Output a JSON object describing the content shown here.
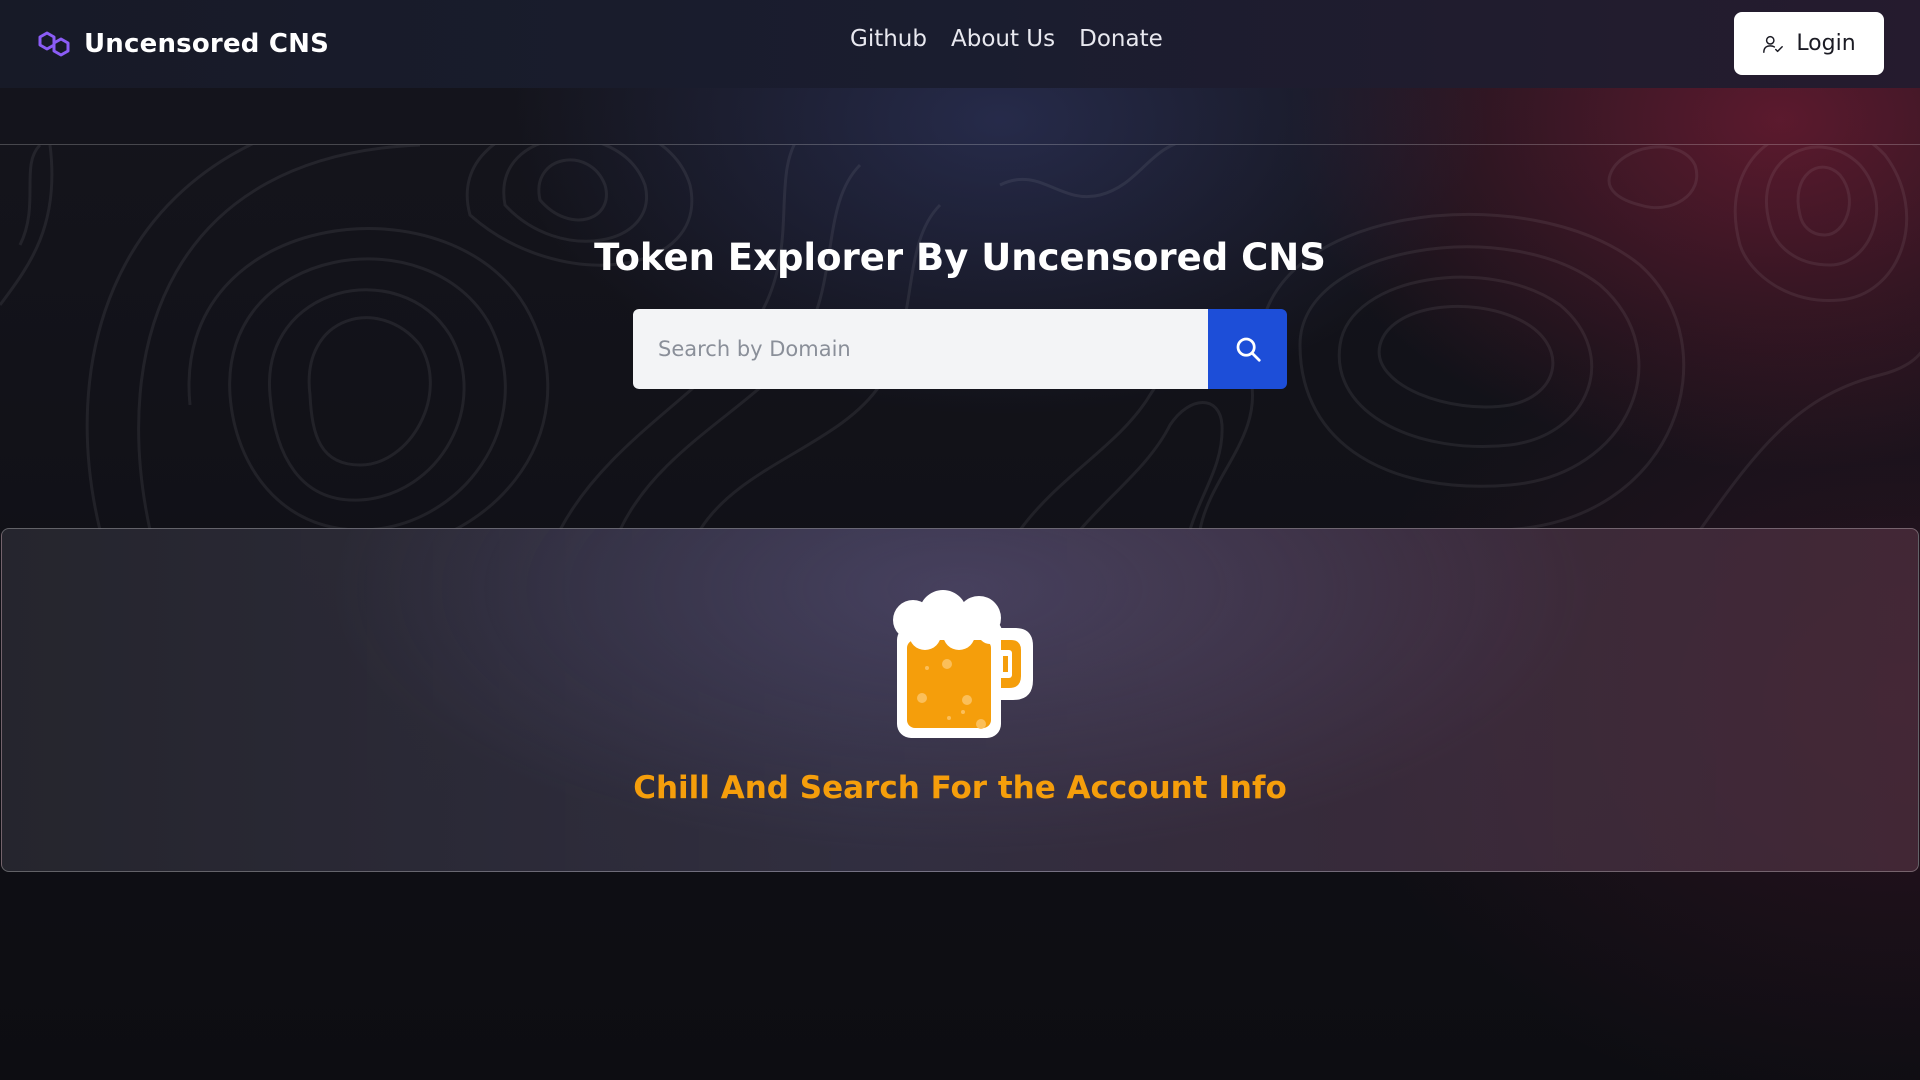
{
  "navbar": {
    "brand_name": "Uncensored CNS",
    "brand_icon": "polygon-link-icon",
    "links": [
      "Github",
      "About Us",
      "Donate"
    ],
    "login_label": "Login",
    "login_icon": "user-check-icon"
  },
  "hero": {
    "title": "Token Explorer By Uncensored CNS",
    "search_placeholder": "Search by Domain",
    "search_value": "",
    "search_icon": "search-icon"
  },
  "empty_state": {
    "icon": "beer-mug-icon",
    "message": "Chill And Search For the Account Info"
  },
  "colors": {
    "brand_accent": "#8b5cf6",
    "search_button": "#1d4ed8",
    "empty_state_text": "#f59e0b",
    "login_button_bg": "#ffffff"
  }
}
